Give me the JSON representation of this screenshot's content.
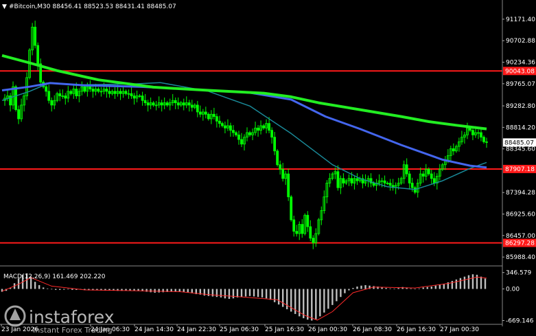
{
  "header": {
    "symbol_text": "#Bitcoin,M30  88456.41 88523.53 88431.41 88485.07"
  },
  "macd_label": "MACD(12,26,9) 161.469 202.220",
  "watermark": {
    "brand": "instaforex",
    "tagline": "Instant Forex Trading"
  },
  "colors": {
    "background": "#000000",
    "candle": "#00ff00",
    "ma_slow": "#22ee22",
    "ma_mid": "#4466ee",
    "ma_fast": "#1a8a99",
    "level": "#ff1a1a",
    "macd_hist": "#bfbfbf",
    "macd_signal": "#ff2a2a",
    "axis": "#ffffff"
  },
  "chart_data": {
    "type": "candlestick",
    "symbol": "#Bitcoin",
    "timeframe": "M30",
    "ohlc_current": {
      "open": 88456.41,
      "high": 88523.53,
      "low": 88431.41,
      "close": 88485.07
    },
    "price_ticks": [
      "91171.40",
      "90702.88",
      "90234.36",
      "89765.07",
      "89282.80",
      "88814.20",
      "88345.60",
      "87394.28",
      "86925.60",
      "86457.00",
      "85988.40"
    ],
    "ylim": [
      85900,
      91380
    ],
    "time_ticks": [
      "23 Jan 2026",
      "24 Jan 06:30",
      "24 Jan 14:30",
      "24 Jan 22:30",
      "25 Jan 06:30",
      "25 Jan 16:30",
      "26 Jan 00:30",
      "26 Jan 08:30",
      "26 Jan 16:30",
      "27 Jan 00:30"
    ],
    "horizontal_levels": [
      {
        "label": "90043.08",
        "value": 90043.08
      },
      {
        "label": "87907.18",
        "value": 87907.18
      },
      {
        "label": "86297.28",
        "value": 86297.28
      }
    ],
    "current_price_label": "88485.07",
    "close_path": [
      [
        0,
        89400
      ],
      [
        4,
        89450
      ],
      [
        8,
        89500
      ],
      [
        12,
        89300
      ],
      [
        16,
        89700
      ],
      [
        20,
        89200
      ],
      [
        24,
        89000
      ],
      [
        28,
        89300
      ],
      [
        32,
        89500
      ],
      [
        36,
        89900
      ],
      [
        40,
        90500
      ],
      [
        44,
        91000
      ],
      [
        48,
        90600
      ],
      [
        52,
        90200
      ],
      [
        56,
        89800
      ],
      [
        60,
        89700
      ],
      [
        64,
        89600
      ],
      [
        68,
        89400
      ],
      [
        72,
        89300
      ],
      [
        76,
        89400
      ],
      [
        80,
        89550
      ],
      [
        84,
        89500
      ],
      [
        88,
        89500
      ],
      [
        92,
        89450
      ],
      [
        96,
        89600
      ],
      [
        100,
        89550
      ],
      [
        104,
        89650
      ],
      [
        108,
        89500
      ],
      [
        112,
        89600
      ],
      [
        116,
        89700
      ],
      [
        120,
        89600
      ],
      [
        124,
        89700
      ],
      [
        128,
        89650
      ],
      [
        132,
        89600
      ],
      [
        136,
        89650
      ],
      [
        140,
        89600
      ],
      [
        144,
        89600
      ],
      [
        148,
        89650
      ],
      [
        152,
        89600
      ],
      [
        156,
        89550
      ],
      [
        160,
        89600
      ],
      [
        164,
        89550
      ],
      [
        168,
        89600
      ],
      [
        172,
        89550
      ],
      [
        176,
        89600
      ],
      [
        180,
        89550
      ],
      [
        184,
        89550
      ],
      [
        188,
        89500
      ],
      [
        192,
        89450
      ],
      [
        196,
        89500
      ],
      [
        200,
        89500
      ],
      [
        204,
        89400
      ],
      [
        208,
        89350
      ],
      [
        212,
        89300
      ],
      [
        216,
        89350
      ],
      [
        220,
        89300
      ],
      [
        224,
        89300
      ],
      [
        228,
        89350
      ],
      [
        232,
        89300
      ],
      [
        236,
        89350
      ],
      [
        240,
        89300
      ],
      [
        244,
        89350
      ],
      [
        248,
        89400
      ],
      [
        252,
        89350
      ],
      [
        256,
        89300
      ],
      [
        260,
        89350
      ],
      [
        264,
        89300
      ],
      [
        268,
        89350
      ],
      [
        272,
        89300
      ],
      [
        276,
        89250
      ],
      [
        280,
        89300
      ],
      [
        284,
        89150
      ],
      [
        288,
        89100
      ],
      [
        292,
        89150
      ],
      [
        296,
        89100
      ],
      [
        300,
        89000
      ],
      [
        304,
        89100
      ],
      [
        308,
        89050
      ],
      [
        312,
        88950
      ],
      [
        316,
        88900
      ],
      [
        320,
        88850
      ],
      [
        324,
        88800
      ],
      [
        328,
        88850
      ],
      [
        332,
        88750
      ],
      [
        336,
        88700
      ],
      [
        340,
        88650
      ],
      [
        344,
        88550
      ],
      [
        348,
        88450
      ],
      [
        352,
        88600
      ],
      [
        356,
        88700
      ],
      [
        360,
        88650
      ],
      [
        364,
        88700
      ],
      [
        368,
        88800
      ],
      [
        372,
        88750
      ],
      [
        376,
        88850
      ],
      [
        380,
        88800
      ],
      [
        384,
        88900
      ],
      [
        388,
        88750
      ],
      [
        392,
        88600
      ],
      [
        396,
        88300
      ],
      [
        400,
        88000
      ],
      [
        404,
        87900
      ],
      [
        408,
        87700
      ],
      [
        412,
        87800
      ],
      [
        416,
        87300
      ],
      [
        420,
        86800
      ],
      [
        424,
        86550
      ],
      [
        428,
        86500
      ],
      [
        432,
        86700
      ],
      [
        436,
        86500
      ],
      [
        440,
        86900
      ],
      [
        444,
        86650
      ],
      [
        448,
        86400
      ],
      [
        452,
        86300
      ],
      [
        456,
        86500
      ],
      [
        460,
        86800
      ],
      [
        464,
        87000
      ],
      [
        468,
        87300
      ],
      [
        472,
        87600
      ],
      [
        476,
        87700
      ],
      [
        480,
        87800
      ],
      [
        484,
        87850
      ],
      [
        488,
        87500
      ],
      [
        492,
        87700
      ],
      [
        496,
        87600
      ],
      [
        500,
        87650
      ],
      [
        504,
        87700
      ],
      [
        508,
        87600
      ],
      [
        512,
        87700
      ],
      [
        516,
        87650
      ],
      [
        520,
        87700
      ],
      [
        524,
        87600
      ],
      [
        528,
        87650
      ],
      [
        532,
        87700
      ],
      [
        536,
        87600
      ],
      [
        540,
        87550
      ],
      [
        544,
        87600
      ],
      [
        548,
        87650
      ],
      [
        552,
        87650
      ],
      [
        556,
        87600
      ],
      [
        560,
        87600
      ],
      [
        564,
        87550
      ],
      [
        568,
        87500
      ],
      [
        572,
        87550
      ],
      [
        576,
        87600
      ],
      [
        580,
        87700
      ],
      [
        584,
        88000
      ],
      [
        588,
        87800
      ],
      [
        592,
        87600
      ],
      [
        596,
        87500
      ],
      [
        600,
        87400
      ],
      [
        604,
        87600
      ],
      [
        608,
        87800
      ],
      [
        612,
        87750
      ],
      [
        616,
        87900
      ],
      [
        620,
        87800
      ],
      [
        624,
        87700
      ],
      [
        628,
        87600
      ],
      [
        632,
        87750
      ],
      [
        636,
        87900
      ],
      [
        640,
        88000
      ],
      [
        644,
        88100
      ],
      [
        648,
        88200
      ],
      [
        652,
        88350
      ],
      [
        656,
        88300
      ],
      [
        660,
        88400
      ],
      [
        664,
        88500
      ],
      [
        668,
        88600
      ],
      [
        672,
        88650
      ],
      [
        676,
        88800
      ],
      [
        680,
        88750
      ],
      [
        684,
        88650
      ],
      [
        688,
        88700
      ],
      [
        692,
        88700
      ],
      [
        696,
        88600
      ],
      [
        700,
        88500
      ],
      [
        704,
        88485
      ]
    ],
    "ma_slow_path": [
      [
        0,
        90380
      ],
      [
        40,
        90220
      ],
      [
        80,
        90050
      ],
      [
        140,
        89850
      ],
      [
        220,
        89690
      ],
      [
        300,
        89620
      ],
      [
        380,
        89560
      ],
      [
        420,
        89480
      ],
      [
        460,
        89350
      ],
      [
        520,
        89200
      ],
      [
        580,
        89050
      ],
      [
        620,
        88940
      ],
      [
        660,
        88860
      ],
      [
        704,
        88780
      ]
    ],
    "ma_mid_path": [
      [
        0,
        89620
      ],
      [
        40,
        89700
      ],
      [
        70,
        89780
      ],
      [
        120,
        89730
      ],
      [
        200,
        89700
      ],
      [
        280,
        89640
      ],
      [
        360,
        89570
      ],
      [
        420,
        89420
      ],
      [
        470,
        89050
      ],
      [
        520,
        88780
      ],
      [
        580,
        88430
      ],
      [
        640,
        88110
      ],
      [
        680,
        87980
      ],
      [
        704,
        87940
      ]
    ],
    "ma_fast_path": [
      [
        0,
        89400
      ],
      [
        40,
        89600
      ],
      [
        70,
        89790
      ],
      [
        110,
        89740
      ],
      [
        190,
        89760
      ],
      [
        230,
        89790
      ],
      [
        300,
        89600
      ],
      [
        360,
        89280
      ],
      [
        420,
        88680
      ],
      [
        480,
        88000
      ],
      [
        520,
        87700
      ],
      [
        560,
        87520
      ],
      [
        600,
        87460
      ],
      [
        640,
        87650
      ],
      [
        680,
        87920
      ],
      [
        704,
        88050
      ]
    ],
    "macd_ticks": [
      "346.579",
      "0.00",
      "-669.146"
    ],
    "macd_ylim": [
      -720,
      400
    ],
    "macd_hist": [
      [
        0,
        -60
      ],
      [
        6,
        -40
      ],
      [
        12,
        20
      ],
      [
        18,
        120
      ],
      [
        24,
        220
      ],
      [
        30,
        300
      ],
      [
        36,
        330
      ],
      [
        42,
        260
      ],
      [
        48,
        150
      ],
      [
        54,
        80
      ],
      [
        60,
        30
      ],
      [
        66,
        10
      ],
      [
        72,
        -10
      ],
      [
        78,
        -20
      ],
      [
        84,
        -20
      ],
      [
        90,
        -15
      ],
      [
        96,
        -10
      ],
      [
        102,
        -20
      ],
      [
        108,
        -20
      ],
      [
        114,
        -15
      ],
      [
        120,
        -25
      ],
      [
        126,
        -30
      ],
      [
        132,
        -30
      ],
      [
        138,
        -25
      ],
      [
        144,
        -30
      ],
      [
        150,
        -35
      ],
      [
        156,
        -35
      ],
      [
        162,
        -30
      ],
      [
        168,
        -40
      ],
      [
        174,
        -40
      ],
      [
        180,
        -30
      ],
      [
        186,
        -35
      ],
      [
        192,
        -40
      ],
      [
        198,
        -45
      ],
      [
        204,
        -50
      ],
      [
        210,
        -60
      ],
      [
        216,
        -70
      ],
      [
        222,
        -80
      ],
      [
        228,
        -75
      ],
      [
        234,
        -70
      ],
      [
        240,
        -65
      ],
      [
        246,
        -60
      ],
      [
        252,
        -55
      ],
      [
        258,
        -60
      ],
      [
        264,
        -70
      ],
      [
        270,
        -80
      ],
      [
        276,
        -90
      ],
      [
        282,
        -110
      ],
      [
        288,
        -120
      ],
      [
        294,
        -140
      ],
      [
        300,
        -150
      ],
      [
        306,
        -160
      ],
      [
        312,
        -170
      ],
      [
        318,
        -180
      ],
      [
        324,
        -200
      ],
      [
        330,
        -210
      ],
      [
        336,
        -200
      ],
      [
        342,
        -180
      ],
      [
        348,
        -170
      ],
      [
        354,
        -160
      ],
      [
        360,
        -150
      ],
      [
        366,
        -160
      ],
      [
        372,
        -170
      ],
      [
        378,
        -180
      ],
      [
        384,
        -200
      ],
      [
        390,
        -230
      ],
      [
        396,
        -280
      ],
      [
        402,
        -330
      ],
      [
        408,
        -380
      ],
      [
        414,
        -430
      ],
      [
        420,
        -480
      ],
      [
        426,
        -530
      ],
      [
        432,
        -580
      ],
      [
        438,
        -620
      ],
      [
        444,
        -650
      ],
      [
        450,
        -669
      ],
      [
        456,
        -640
      ],
      [
        462,
        -580
      ],
      [
        468,
        -500
      ],
      [
        474,
        -420
      ],
      [
        480,
        -340
      ],
      [
        486,
        -260
      ],
      [
        492,
        -170
      ],
      [
        498,
        -90
      ],
      [
        504,
        -30
      ],
      [
        510,
        20
      ],
      [
        516,
        50
      ],
      [
        522,
        70
      ],
      [
        528,
        80
      ],
      [
        534,
        70
      ],
      [
        540,
        60
      ],
      [
        546,
        50
      ],
      [
        552,
        30
      ],
      [
        558,
        20
      ],
      [
        564,
        10
      ],
      [
        570,
        5
      ],
      [
        576,
        20
      ],
      [
        582,
        40
      ],
      [
        588,
        30
      ],
      [
        594,
        10
      ],
      [
        600,
        0
      ],
      [
        606,
        10
      ],
      [
        612,
        30
      ],
      [
        618,
        40
      ],
      [
        624,
        50
      ],
      [
        630,
        70
      ],
      [
        636,
        90
      ],
      [
        642,
        110
      ],
      [
        648,
        140
      ],
      [
        654,
        170
      ],
      [
        660,
        200
      ],
      [
        666,
        230
      ],
      [
        672,
        260
      ],
      [
        678,
        290
      ],
      [
        684,
        310
      ],
      [
        690,
        300
      ],
      [
        696,
        260
      ],
      [
        702,
        220
      ]
    ],
    "macd_signal": [
      [
        0,
        -50
      ],
      [
        24,
        100
      ],
      [
        42,
        240
      ],
      [
        72,
        60
      ],
      [
        120,
        -20
      ],
      [
        200,
        -40
      ],
      [
        260,
        -60
      ],
      [
        300,
        -120
      ],
      [
        350,
        -170
      ],
      [
        400,
        -230
      ],
      [
        440,
        -560
      ],
      [
        458,
        -660
      ],
      [
        480,
        -480
      ],
      [
        510,
        -80
      ],
      [
        540,
        40
      ],
      [
        600,
        20
      ],
      [
        650,
        120
      ],
      [
        690,
        250
      ],
      [
        704,
        230
      ]
    ]
  }
}
